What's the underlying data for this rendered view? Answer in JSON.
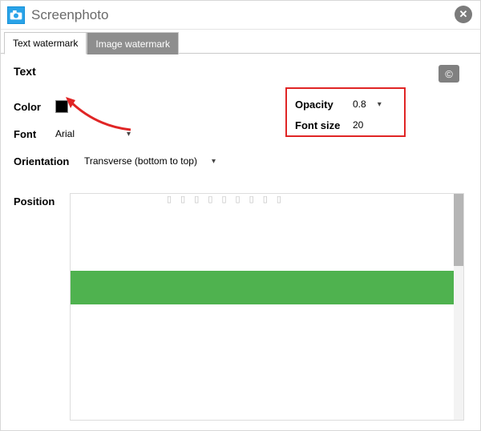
{
  "app": {
    "title": "Screenphoto"
  },
  "tabs": {
    "text_watermark": "Text watermark",
    "image_watermark": "Image watermark"
  },
  "section": {
    "text_heading": "Text"
  },
  "labels": {
    "color": "Color",
    "font": "Font",
    "orientation": "Orientation",
    "position": "Position",
    "opacity": "Opacity",
    "font_size": "Font size"
  },
  "values": {
    "color_hex": "#000000",
    "font": "Arial",
    "orientation": "Transverse (bottom to top)",
    "opacity": "0.8",
    "font_size": "20"
  },
  "icons": {
    "copyright": "©",
    "close": "✕"
  },
  "preview": {
    "toolbar_hint": "▯ ▯  ▯  ▯  ▯ ▯ ▯ ▯ ▯"
  }
}
